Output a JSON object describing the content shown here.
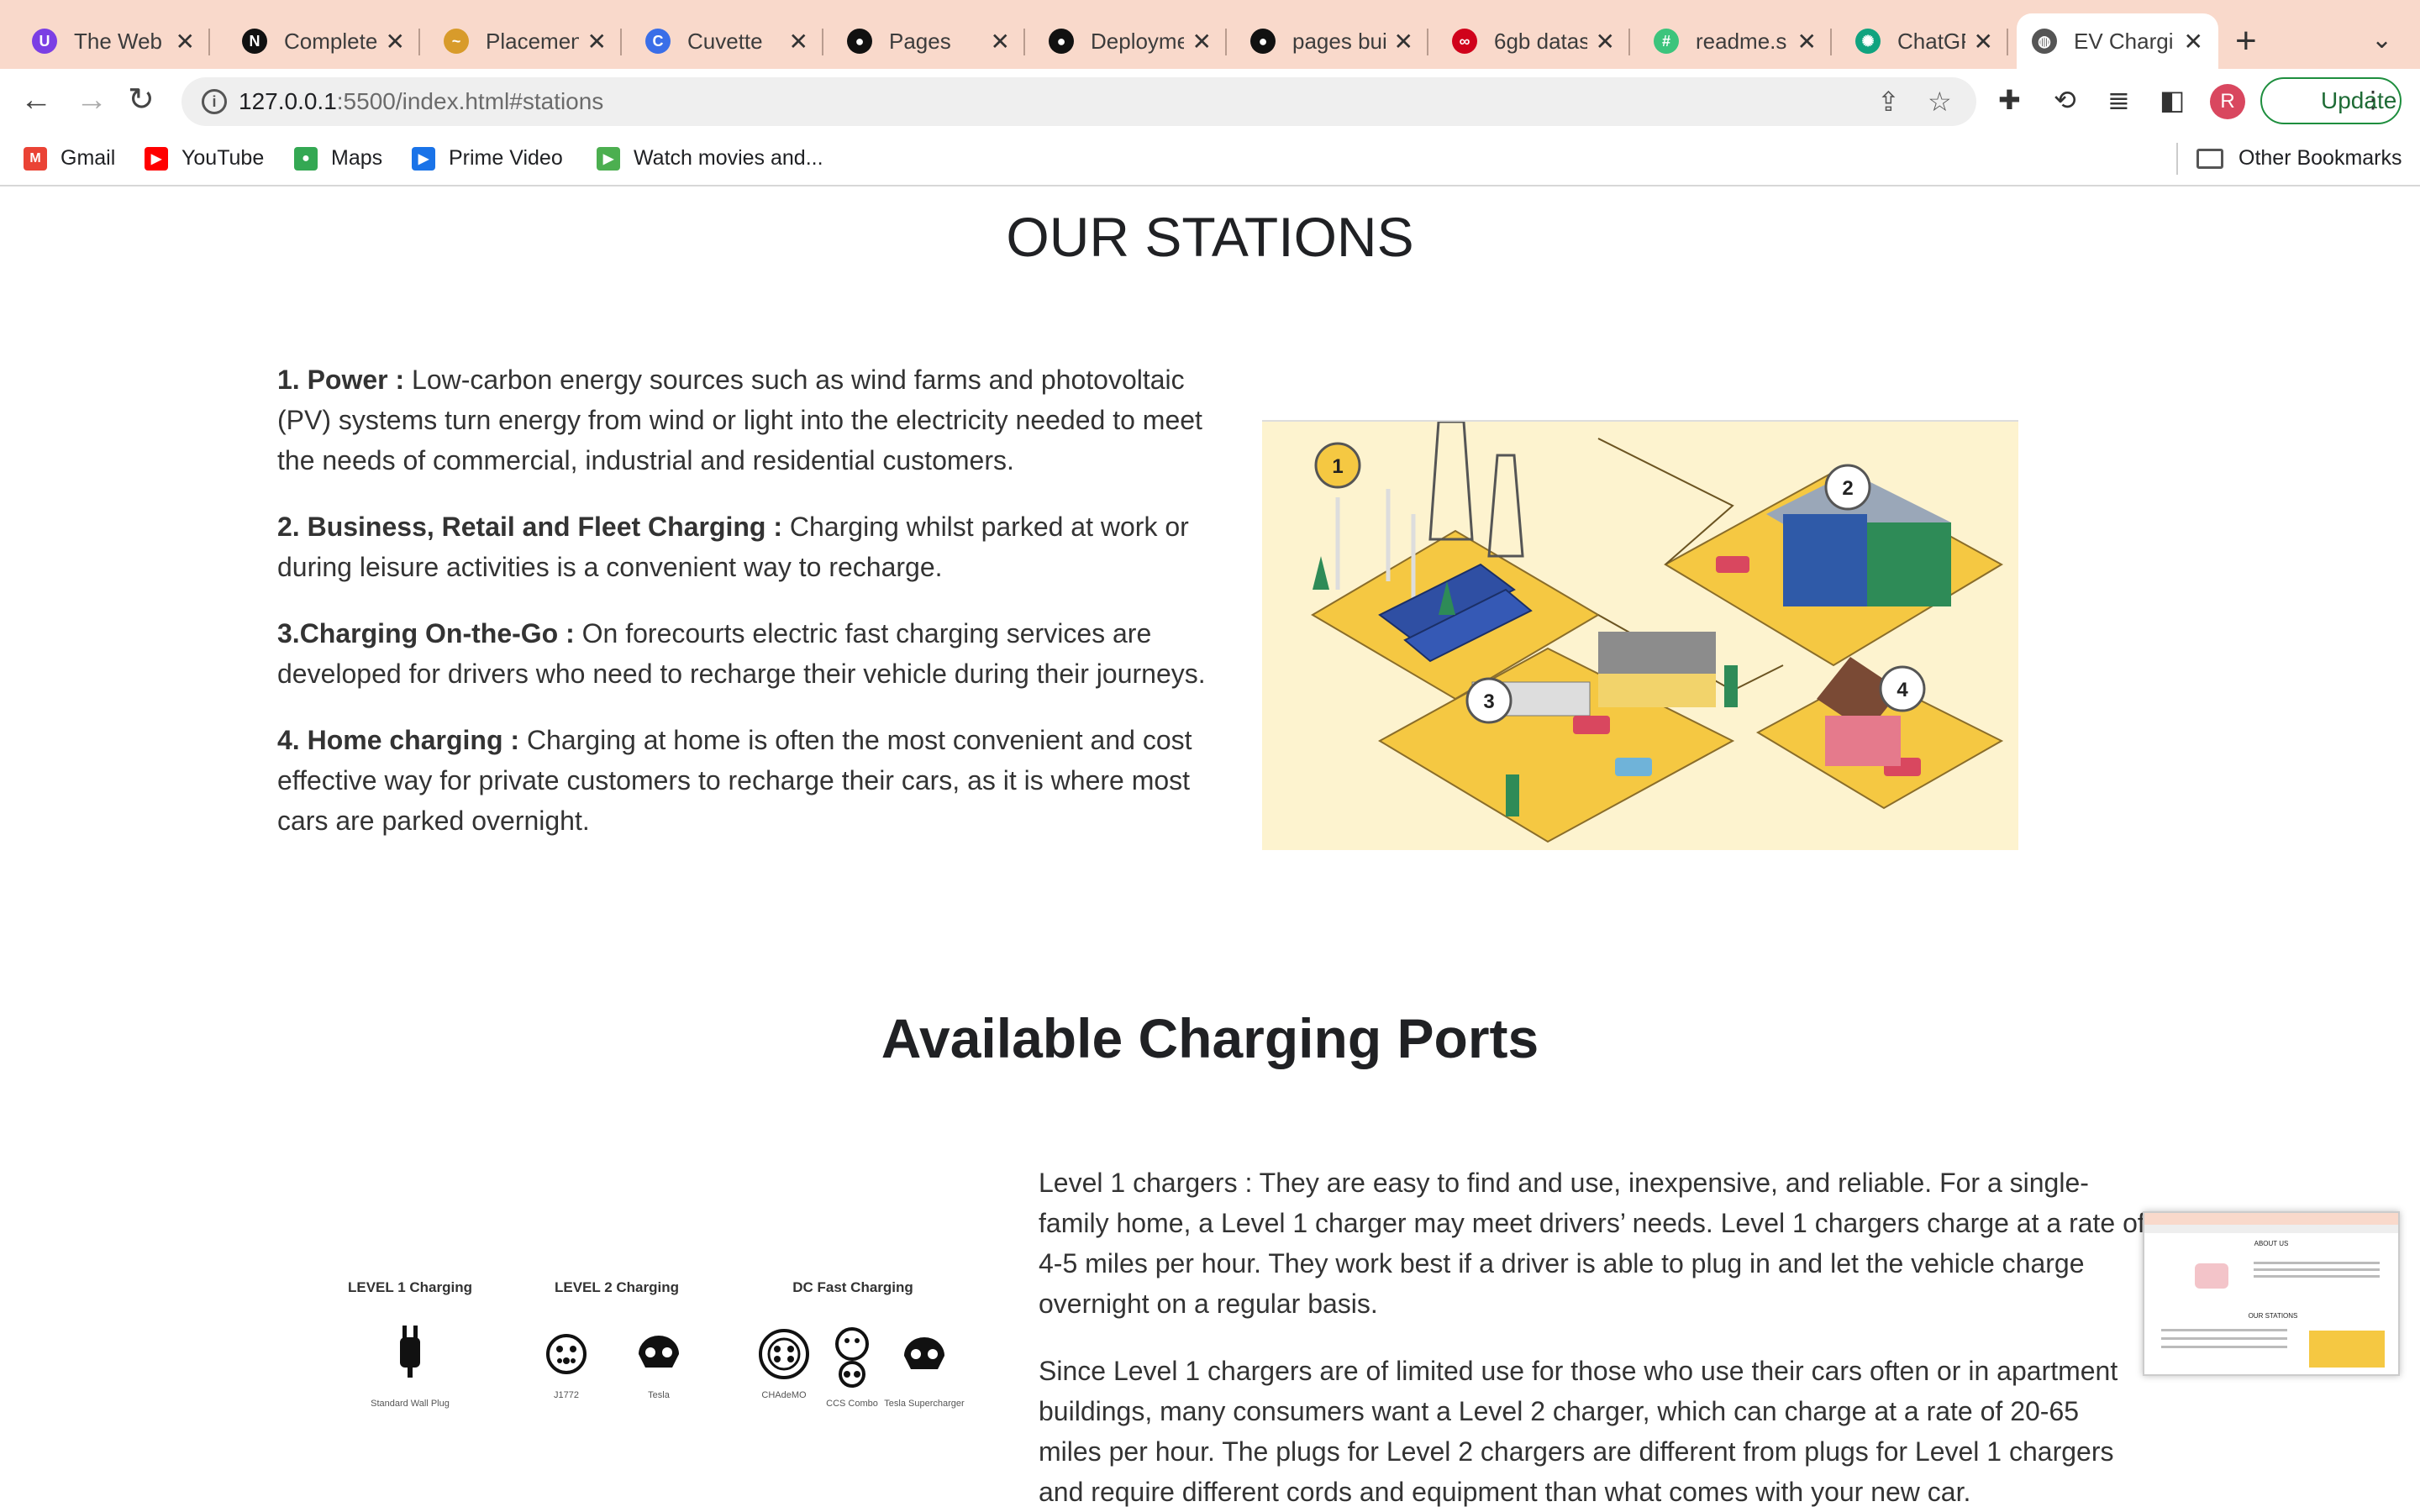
{
  "browser": {
    "tabs": [
      {
        "title": "The Web",
        "icon": "U",
        "color": "#7b3fe4"
      },
      {
        "title": "Complete",
        "icon": "N",
        "color": "#111111"
      },
      {
        "title": "Placemen",
        "icon": "~",
        "color": "#d89b2b"
      },
      {
        "title": "Cuvette",
        "icon": "C",
        "color": "#3a6ee8"
      },
      {
        "title": "Pages",
        "icon": "gh",
        "color": "#111111"
      },
      {
        "title": "Deployme",
        "icon": "gh",
        "color": "#111111"
      },
      {
        "title": "pages bui",
        "icon": "gh",
        "color": "#111111"
      },
      {
        "title": "6gb datas",
        "icon": "co",
        "color": "#d0021b"
      },
      {
        "title": "readme.s",
        "icon": "#",
        "color": "#3cc47c"
      },
      {
        "title": "ChatGPT",
        "icon": "AI",
        "color": "#10a37f"
      },
      {
        "title": "EV Chargi",
        "icon": "globe",
        "color": "#555555"
      }
    ],
    "active_tab_index": 10,
    "url_host": "127.0.0.1",
    "url_path": ":5500/index.html#stations",
    "avatar_letter": "R",
    "update_label": "Update",
    "bookmarks": [
      {
        "label": "Gmail",
        "icon": "M",
        "color": "#ea4335"
      },
      {
        "label": "YouTube",
        "icon": "▶",
        "color": "#ff0000"
      },
      {
        "label": "Maps",
        "icon": "●",
        "color": "#34a853"
      },
      {
        "label": "Prime Video",
        "icon": "▶",
        "color": "#1a73e8"
      },
      {
        "label": "Watch movies and...",
        "icon": "▶",
        "color": "#4caf50"
      }
    ],
    "other_bookmarks": "Other Bookmarks"
  },
  "stations": {
    "heading": "OUR STATIONS",
    "items": [
      {
        "title": "1. Power :",
        "text": " Low-carbon energy sources such as wind farms and photovoltaic (PV) systems turn energy from wind or light into the electricity needed to meet the needs of commercial, industrial and residential customers."
      },
      {
        "title": "2. Business, Retail and Fleet Charging :",
        "text": " Charging whilst parked at work or during leisure activities is a convenient way to recharge."
      },
      {
        "title": "3.Charging On-the-Go :",
        "text": " On forecourts electric fast charging services are developed for drivers who need to recharge their vehicle during their journeys."
      },
      {
        "title": "4. Home charging :",
        "text": " Charging at home is often the most convenient and cost effective way for private customers to recharge their cars, as it is where most cars are parked overnight."
      }
    ],
    "illustration_markers": [
      "1",
      "2",
      "3",
      "4"
    ]
  },
  "ports": {
    "heading": "Available Charging Ports",
    "paragraphs": [
      "Level 1 chargers : They are easy to find and use, inexpensive, and reliable. For a single-family home, a Level 1 charger may meet drivers’ needs. Level 1 chargers charge at a rate of 4-5 miles per hour. They work best if a driver is able to plug in and let the vehicle charge overnight on a regular basis.",
      "Since Level 1 chargers are of limited use for those who use their cars often or in apartment buildings, many consumers want a Level 2 charger, which can charge at a rate of 20-65 miles per hour. The plugs for Level 2 chargers are different from plugs for Level 1 chargers and require different cords and equipment than what comes with your new car."
    ],
    "diagram": {
      "groups": [
        "LEVEL 1 Charging",
        "LEVEL 2  Charging",
        "DC Fast Charging"
      ],
      "plugs": [
        "Standard Wall Plug",
        "J1772",
        "Tesla",
        "CHAdeMO",
        "CCS Combo",
        "Tesla Supercharger"
      ]
    }
  },
  "preview_thumbnail": {
    "headings": [
      "ABOUT US",
      "OUR STATIONS"
    ]
  }
}
